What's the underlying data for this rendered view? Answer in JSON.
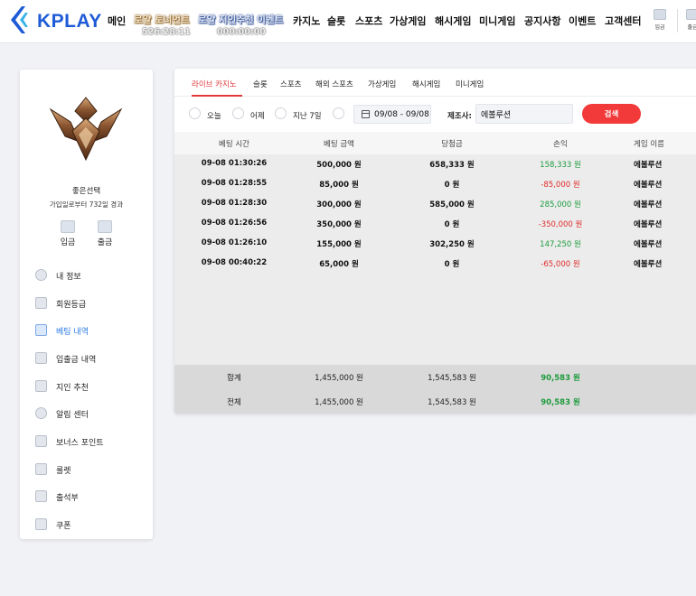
{
  "header": {
    "logo_text": "KPLAY",
    "nav": [
      {
        "id": "main",
        "label": "메인"
      },
      {
        "id": "casino",
        "label": "카지노"
      },
      {
        "id": "slot",
        "label": "슬롯"
      },
      {
        "id": "sports",
        "label": "스포츠"
      },
      {
        "id": "virtual",
        "label": "가상게임"
      },
      {
        "id": "hash",
        "label": "해시게임"
      },
      {
        "id": "mini",
        "label": "미니게임"
      },
      {
        "id": "notice",
        "label": "공지사항"
      },
      {
        "id": "event",
        "label": "이벤트"
      },
      {
        "id": "support",
        "label": "고객센터"
      }
    ],
    "promos": [
      {
        "id": "tournament",
        "label": "로얄 토너먼트",
        "timer": "526:28:11"
      },
      {
        "id": "referral",
        "label": "로얄 지인추천 이벤트",
        "timer": "000:00:00"
      }
    ],
    "deposit_label": "입금",
    "withdraw_label": "출금"
  },
  "sidebar": {
    "user_name": "좋은선택",
    "join_info": "가입일로부터 732일 경과",
    "deposit_label": "입금",
    "withdraw_label": "출금",
    "menu": [
      {
        "id": "my-info",
        "label": "내 정보",
        "icon": "user-icon"
      },
      {
        "id": "member-grade",
        "label": "회원등급",
        "icon": "shield-icon"
      },
      {
        "id": "bet-history",
        "label": "베팅 내역",
        "icon": "receipt-icon",
        "active": true
      },
      {
        "id": "cash-history",
        "label": "입출금 내역",
        "icon": "wallet-icon"
      },
      {
        "id": "referral",
        "label": "지인 추천",
        "icon": "heart-icon"
      },
      {
        "id": "notifications",
        "label": "알림 센터",
        "icon": "chat-icon"
      },
      {
        "id": "bonus-points",
        "label": "보너스 포인트",
        "icon": "coin-icon"
      },
      {
        "id": "roulette",
        "label": "룰렛",
        "icon": "roulette-icon"
      },
      {
        "id": "attendance",
        "label": "출석부",
        "icon": "calendar-check-icon"
      },
      {
        "id": "coupon",
        "label": "쿠폰",
        "icon": "coupon-icon"
      }
    ]
  },
  "tabs": [
    {
      "id": "live-casino",
      "label": "라이브 카지노",
      "active": true
    },
    {
      "id": "slot",
      "label": "슬롯"
    },
    {
      "id": "sports",
      "label": "스포츠"
    },
    {
      "id": "overseas-sports",
      "label": "해외 스포츠"
    },
    {
      "id": "virtual",
      "label": "가상게임"
    },
    {
      "id": "hash",
      "label": "해시게임"
    },
    {
      "id": "mini",
      "label": "미니게임"
    }
  ],
  "filters": {
    "periods": [
      {
        "id": "today",
        "label": "오늘"
      },
      {
        "id": "yesterday",
        "label": "어제"
      },
      {
        "id": "last7",
        "label": "지난 7일"
      }
    ],
    "date_range": "09/08 - 09/08",
    "provider_label": "제조사:",
    "provider_value": "에볼루션",
    "search_label": "검색"
  },
  "table": {
    "columns": [
      "베팅 시간",
      "베팅 금액",
      "당첨금",
      "손익",
      "게임 이름"
    ],
    "rows": [
      {
        "time": "09-08 01:30:26",
        "bet": "500,000 원",
        "win": "658,333 원",
        "profit": "158,333 원",
        "positive": true,
        "game": "에볼루션"
      },
      {
        "time": "09-08 01:28:55",
        "bet": "85,000 원",
        "win": "0 원",
        "profit": "-85,000 원",
        "positive": false,
        "game": "에볼루션"
      },
      {
        "time": "09-08 01:28:30",
        "bet": "300,000 원",
        "win": "585,000 원",
        "profit": "285,000 원",
        "positive": true,
        "game": "에볼루션"
      },
      {
        "time": "09-08 01:26:56",
        "bet": "350,000 원",
        "win": "0 원",
        "profit": "-350,000 원",
        "positive": false,
        "game": "에볼루션"
      },
      {
        "time": "09-08 01:26:10",
        "bet": "155,000 원",
        "win": "302,250 원",
        "profit": "147,250 원",
        "positive": true,
        "game": "에볼루션"
      },
      {
        "time": "09-08 00:40:22",
        "bet": "65,000 원",
        "win": "0 원",
        "profit": "-65,000 원",
        "positive": false,
        "game": "에볼루션"
      }
    ],
    "footer": [
      {
        "label": "합계",
        "bet": "1,455,000 원",
        "win": "1,545,583 원",
        "profit": "90,583 원"
      },
      {
        "label": "전체",
        "bet": "1,455,000 원",
        "win": "1,545,583 원",
        "profit": "90,583 원"
      }
    ]
  },
  "colors": {
    "brand": "#1f5bd6",
    "active_tab": "#e23a3a",
    "search_button": "#f23a3a",
    "profit_positive": "#1c9b3c",
    "profit_negative": "#e02b2b",
    "sidebar_active": "#2c7be5"
  }
}
